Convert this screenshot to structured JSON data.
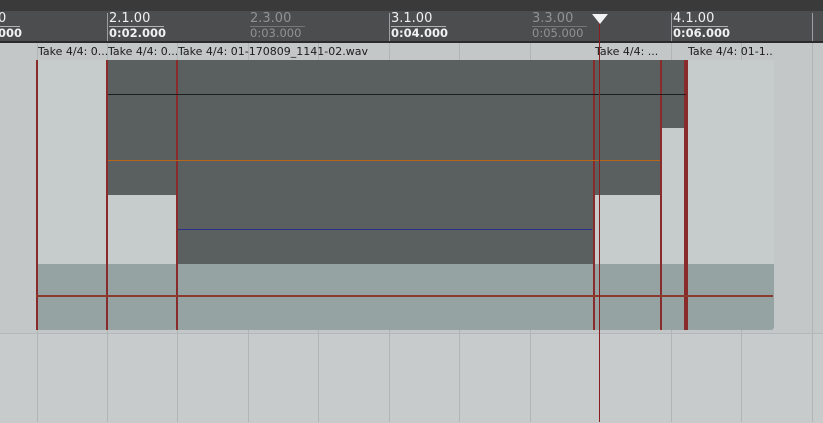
{
  "ruler": {
    "ticks": [
      {
        "bar": "0",
        "time": "000"
      },
      {
        "bar": "2.1.00",
        "time": "0:02.000"
      },
      {
        "bar": "2.3.00",
        "time": "0:03.000"
      },
      {
        "bar": "3.1.00",
        "time": "0:04.000"
      },
      {
        "bar": "3.3.00",
        "time": "0:05.000"
      },
      {
        "bar": "4.1.00",
        "time": "0:06.000"
      }
    ]
  },
  "items": [
    {
      "label": "Take 4/4: 0..."
    },
    {
      "label": "Take 4/4: 0..."
    },
    {
      "label": "Take 4/4: 01-170809_1141-02.wav"
    },
    {
      "label": "Take 4/4: ..."
    },
    {
      "label": ""
    },
    {
      "label": "Take 4/4: 01-1..."
    }
  ],
  "colors": {
    "playhead": "#8a1e1e",
    "item_edge": "#8a2b2b",
    "envelope_orange": "#b8641a",
    "envelope_blue": "#2b2f8a"
  }
}
